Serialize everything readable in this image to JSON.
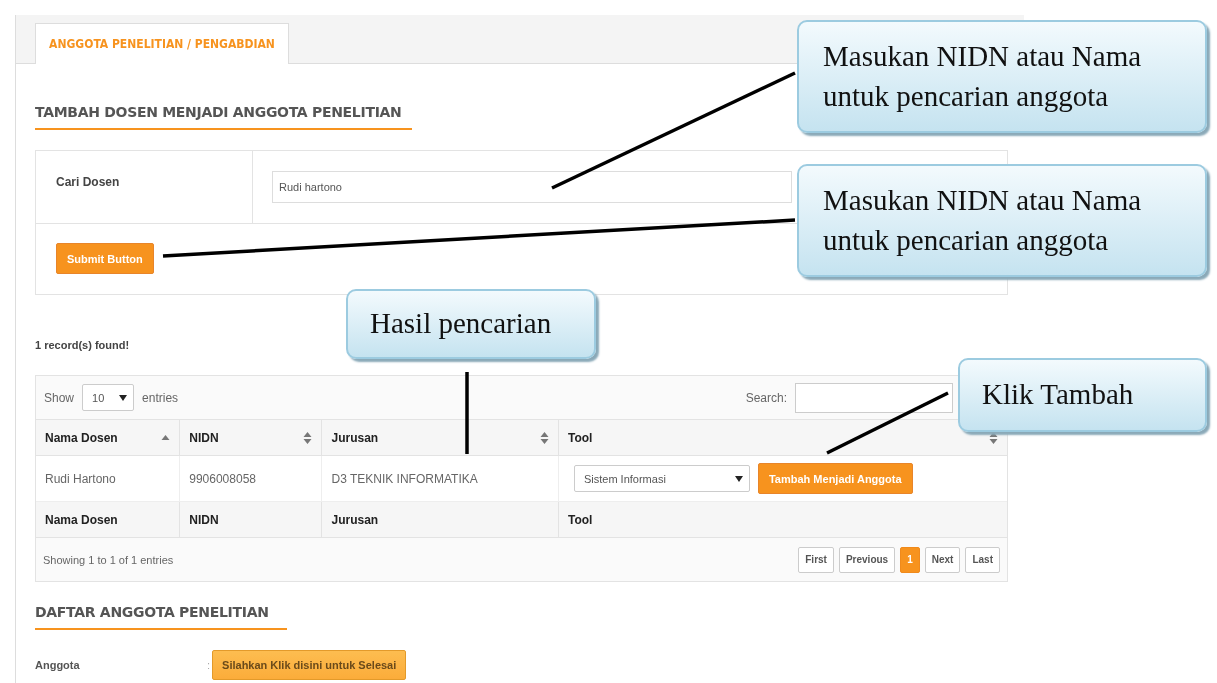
{
  "tab": {
    "label": "ANGGOTA PENELITIAN / PENGABDIAN",
    "selected": true
  },
  "add_section": {
    "heading": "TAMBAH DOSEN MENJADI ANGGOTA PENELITIAN",
    "search_label": "Cari Dosen",
    "search_value": "Rudi hartono",
    "submit": "Submit Button"
  },
  "result_count": "1 record(s) found!",
  "table": {
    "show_label": "Show",
    "length_value": "10",
    "entries_label": "entries",
    "search_label": "Search:",
    "columns": [
      {
        "label": "Nama Dosen",
        "sorted": true
      },
      {
        "label": "NIDN",
        "sorted": false
      },
      {
        "label": "Jurusan",
        "sorted": false
      },
      {
        "label": "Tool",
        "sorted": false
      }
    ],
    "rows": [
      {
        "nama": "Rudi Hartono",
        "nidn": "9906008058",
        "jurusan": "D3 TEKNIK INFORMATIKA",
        "tool_select": "Sistem Informasi",
        "tool_button": "Tambah Menjadi Anggota"
      }
    ],
    "footer_columns": [
      "Nama Dosen",
      "NIDN",
      "Jurusan",
      "Tool"
    ],
    "info": "Showing 1 to 1 of 1 entries",
    "pagination": [
      {
        "label": "First",
        "selected": false
      },
      {
        "label": "Previous",
        "selected": false
      },
      {
        "label": "1",
        "selected": true
      },
      {
        "label": "Next",
        "selected": false
      },
      {
        "label": "Last",
        "selected": false
      }
    ]
  },
  "member_section": {
    "heading": "DAFTAR ANGGOTA PENELITIAN",
    "label": "Anggota",
    "separator": ":",
    "button": "Silahkan Klik disini untuk Selesai"
  },
  "callouts": [
    {
      "text": "Masukan NIDN atau Nama untuk pencarian anggota",
      "kind": "wide"
    },
    {
      "text": "Masukan NIDN atau Nama untuk pencarian anggota",
      "kind": "wide"
    },
    {
      "text": "Hasil pencarian",
      "kind": "small"
    },
    {
      "text": "Klik Tambah",
      "kind": "small"
    }
  ]
}
